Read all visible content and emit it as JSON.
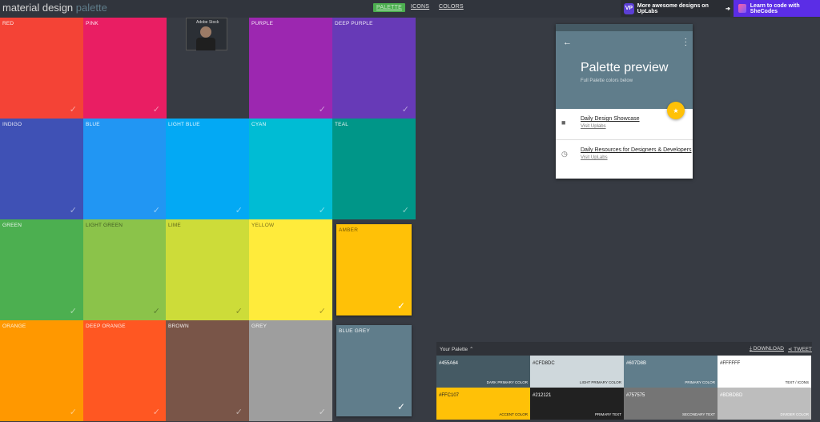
{
  "header": {
    "logo_main": "material design",
    "logo_accent": "palette",
    "nav": [
      "PALETTE",
      "ICONS",
      "COLORS"
    ],
    "uplabs_badge": "VP",
    "uplabs_text": "More awesome designs on UpLabs",
    "shecodes_text": "Learn to code with SheCodes"
  },
  "colors": [
    {
      "name": "RED",
      "hex": "#f44336"
    },
    {
      "name": "PINK",
      "hex": "#e91e63"
    },
    {
      "name": "PURPLE",
      "hex": "#9c27b0"
    },
    {
      "name": "DEEP PURPLE",
      "hex": "#673ab7"
    },
    {
      "name": "INDIGO",
      "hex": "#3f51b5"
    },
    {
      "name": "BLUE",
      "hex": "#2196f3"
    },
    {
      "name": "LIGHT BLUE",
      "hex": "#03a9f4"
    },
    {
      "name": "CYAN",
      "hex": "#00bcd4"
    },
    {
      "name": "TEAL",
      "hex": "#009688"
    },
    {
      "name": "GREEN",
      "hex": "#4caf50"
    },
    {
      "name": "LIGHT GREEN",
      "hex": "#8bc34a"
    },
    {
      "name": "LIME",
      "hex": "#cddc39"
    },
    {
      "name": "YELLOW",
      "hex": "#ffeb3b"
    },
    {
      "name": "AMBER",
      "hex": "#ffc107"
    },
    {
      "name": "ORANGE",
      "hex": "#ff9800"
    },
    {
      "name": "DEEP ORANGE",
      "hex": "#ff5722"
    },
    {
      "name": "BROWN",
      "hex": "#795548"
    },
    {
      "name": "GREY",
      "hex": "#9e9e9e"
    },
    {
      "name": "BLUE GREY",
      "hex": "#607d8b"
    }
  ],
  "video_overlay": {
    "label": "Adobe Stock"
  },
  "preview": {
    "title": "Palette preview",
    "subtitle": "Full Palette colors below",
    "items": [
      {
        "title": "Daily Design Showcase",
        "link": "Visit Uplabs",
        "icon": "label-icon"
      },
      {
        "title": "Daily Resources for Designers & Developers",
        "link": "Visit UpLabs",
        "icon": "clock-icon"
      }
    ]
  },
  "your_palette": {
    "title": "Your Palette",
    "download": "DOWNLOAD",
    "tweet": "TWEET",
    "swatches": [
      {
        "hex": "#455A64",
        "role": "DARK PRIMARY COLOR",
        "bg": "#455a64",
        "fg": "#ffffff"
      },
      {
        "hex": "#CFD8DC",
        "role": "LIGHT PRIMARY COLOR",
        "bg": "#cfd8dc",
        "fg": "#212121"
      },
      {
        "hex": "#607D8B",
        "role": "PRIMARY COLOR",
        "bg": "#607d8b",
        "fg": "#ffffff"
      },
      {
        "hex": "#FFFFFF",
        "role": "TEXT / ICONS",
        "bg": "#ffffff",
        "fg": "#212121"
      },
      {
        "hex": "#FFC107",
        "role": "ACCENT COLOR",
        "bg": "#ffc107",
        "fg": "#212121"
      },
      {
        "hex": "#212121",
        "role": "PRIMARY TEXT",
        "bg": "#212121",
        "fg": "#ffffff"
      },
      {
        "hex": "#757575",
        "role": "SECONDARY TEXT",
        "bg": "#757575",
        "fg": "#ffffff"
      },
      {
        "hex": "#BDBDBD",
        "role": "DIVIDER COLOR",
        "bg": "#bdbdbd",
        "fg": "#ffffff"
      }
    ]
  }
}
